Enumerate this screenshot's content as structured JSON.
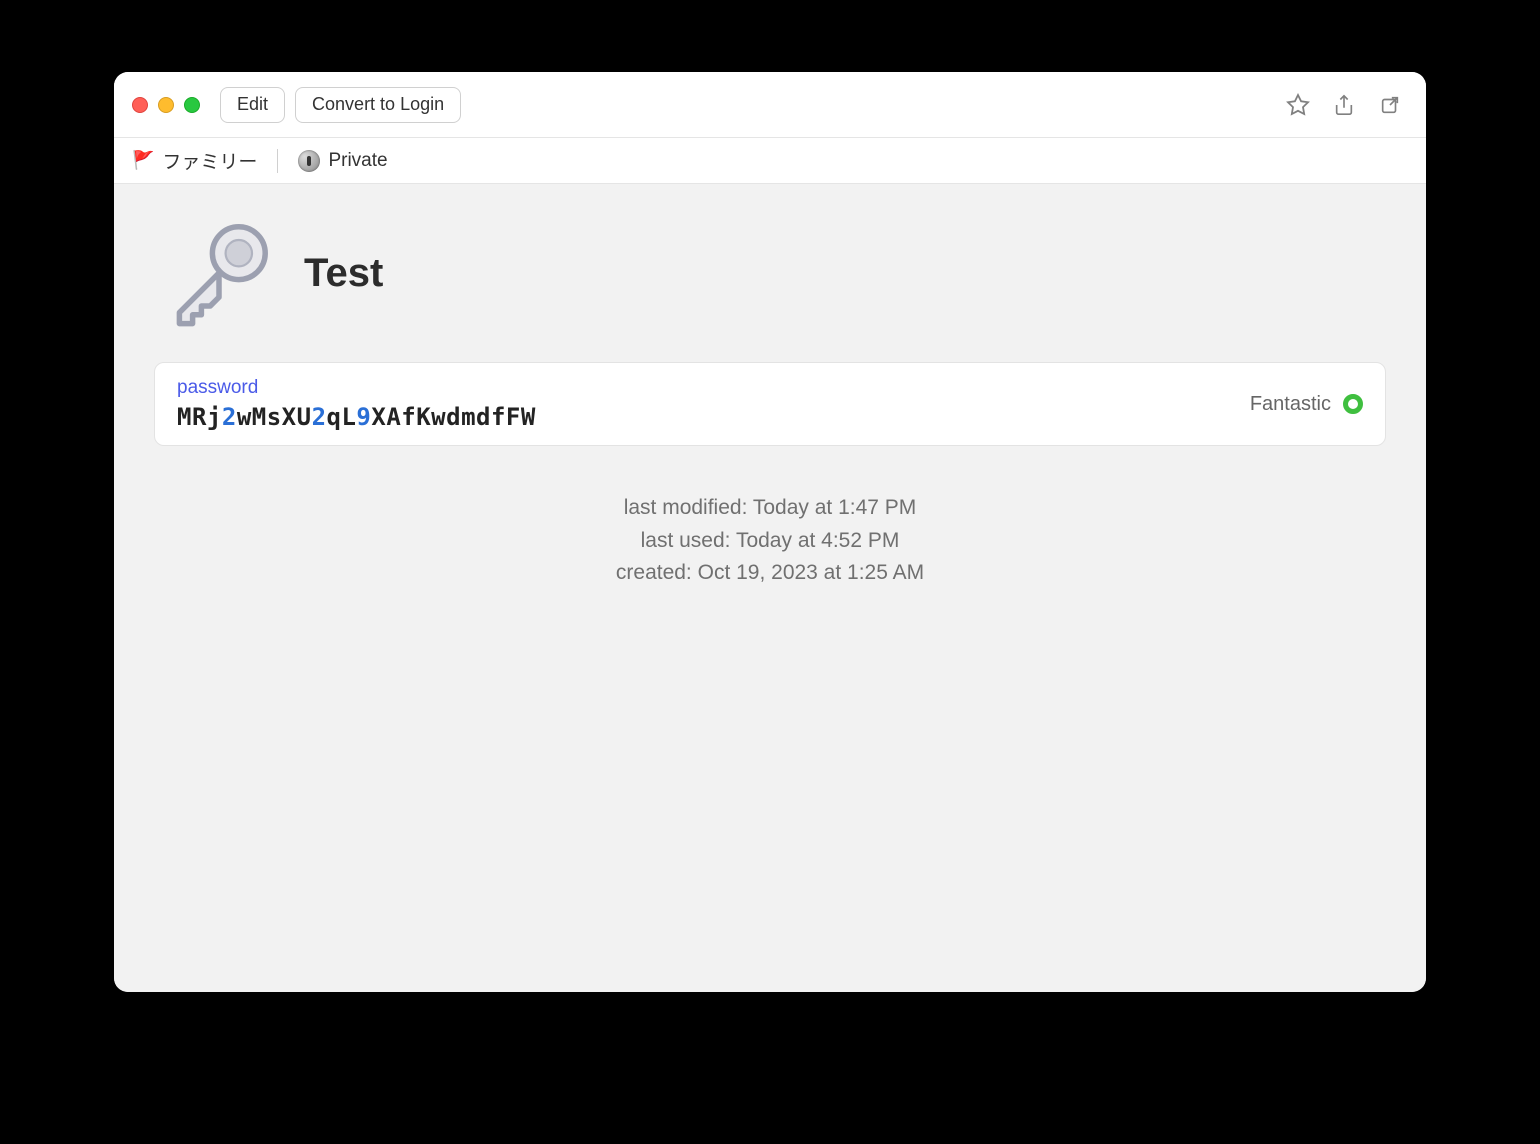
{
  "toolbar": {
    "edit_label": "Edit",
    "convert_label": "Convert to Login"
  },
  "breadcrumb": {
    "account_label": "ファミリー",
    "vault_label": "Private"
  },
  "item": {
    "title": "Test"
  },
  "password_field": {
    "label": "password",
    "segments": [
      {
        "t": "MRj",
        "c": "alpha"
      },
      {
        "t": "2",
        "c": "digit"
      },
      {
        "t": "wMsXU",
        "c": "alpha"
      },
      {
        "t": "2",
        "c": "digit"
      },
      {
        "t": "qL",
        "c": "alpha"
      },
      {
        "t": "9",
        "c": "digit"
      },
      {
        "t": "XAfKwdmdfFW",
        "c": "alpha"
      }
    ],
    "strength_label": "Fantastic"
  },
  "metadata": {
    "last_modified": "last modified: Today at 1:47 PM",
    "last_used": "last used: Today at 4:52 PM",
    "created": "created: Oct 19, 2023 at 1:25 AM"
  }
}
